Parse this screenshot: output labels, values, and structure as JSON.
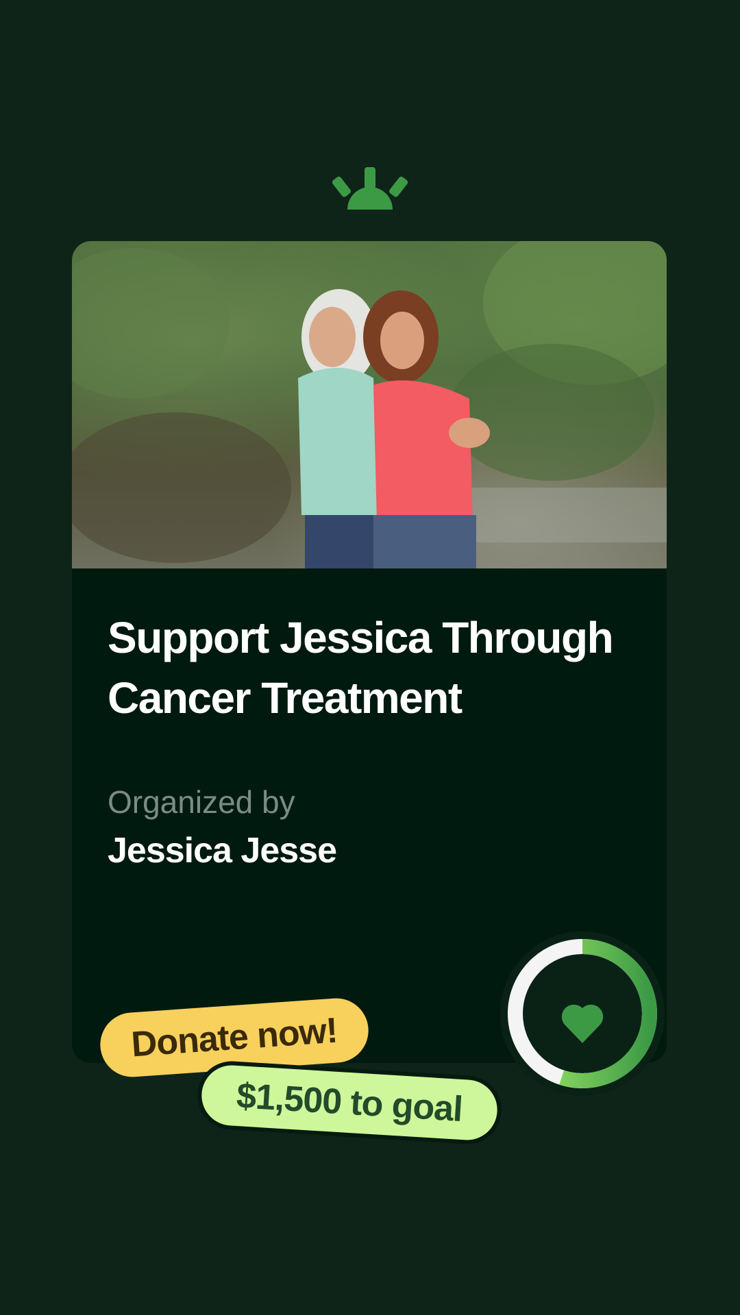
{
  "brand": {
    "logo_icon": "sun-logo-icon",
    "accent": "#3c9a45"
  },
  "fundraiser": {
    "photo_description": "two-women-photo",
    "title": "Support Jessica Through Cancer Treatment",
    "organized_by_label": "Organized by",
    "organizer_name": "Jessica Jesse"
  },
  "actions": {
    "donate_label": "Donate now!",
    "goal_label": "$1,500 to goal"
  },
  "progress": {
    "icon": "heart-icon",
    "fraction": 0.55,
    "colors": {
      "track": "#f4f4f4",
      "fill_start": "#a7ee6a",
      "fill_end": "#3c9a45",
      "heart": "#3c9a45"
    }
  }
}
